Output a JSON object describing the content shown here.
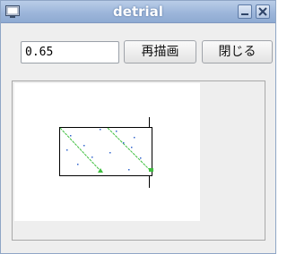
{
  "window": {
    "title": "detrial"
  },
  "controls": {
    "input_value": "0.65",
    "redraw_label": "再描画",
    "close_label": "閉じる"
  },
  "icons": {
    "app": "window-icon",
    "minimize": "minimize-icon",
    "close": "close-icon"
  },
  "colors": {
    "titlebar": "#9db6da",
    "plot_line": "#3fbf3f",
    "plot_dots": "#3366cc"
  }
}
